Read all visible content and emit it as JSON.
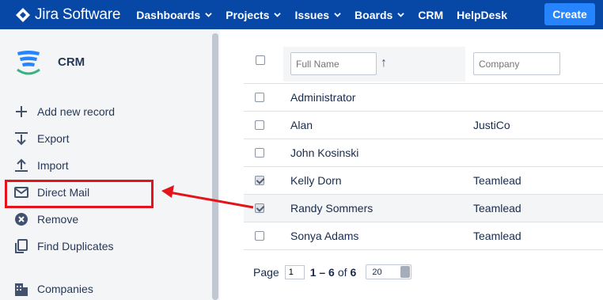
{
  "topbar": {
    "logo_text": "Jira Software",
    "nav": [
      {
        "label": "Dashboards",
        "has_caret": true
      },
      {
        "label": "Projects",
        "has_caret": true
      },
      {
        "label": "Issues",
        "has_caret": true
      },
      {
        "label": "Boards",
        "has_caret": true
      },
      {
        "label": "CRM",
        "has_caret": false
      },
      {
        "label": "HelpDesk",
        "has_caret": false
      }
    ],
    "create_label": "Create",
    "colors": {
      "bar": "#0747a6",
      "create": "#2684ff"
    }
  },
  "sidebar": {
    "project_name": "CRM",
    "items": [
      {
        "label": "Add new record",
        "icon": "plus-icon"
      },
      {
        "label": "Export",
        "icon": "export-icon"
      },
      {
        "label": "Import",
        "icon": "import-icon"
      },
      {
        "label": "Direct Mail",
        "icon": "mail-icon",
        "highlighted": true
      },
      {
        "label": "Remove",
        "icon": "remove-icon"
      },
      {
        "label": "Find Duplicates",
        "icon": "duplicates-icon"
      },
      {
        "label": "Companies",
        "icon": "companies-icon"
      }
    ],
    "highlight_color": "#e3141c"
  },
  "table": {
    "filters": {
      "name_placeholder": "Full Name",
      "company_placeholder": "Company"
    },
    "sort_icon": "sort-arrow-up-icon",
    "rows": [
      {
        "name": "Administrator",
        "company": "",
        "checked": false
      },
      {
        "name": "Alan",
        "company": "JustiCo",
        "checked": false
      },
      {
        "name": "John Kosinski",
        "company": "",
        "checked": false
      },
      {
        "name": "Kelly Dorn",
        "company": "Teamlead",
        "checked": true
      },
      {
        "name": "Randy Sommers",
        "company": "Teamlead",
        "checked": true
      },
      {
        "name": "Sonya Adams",
        "company": "Teamlead",
        "checked": false
      }
    ]
  },
  "pager": {
    "page_label": "Page",
    "page_value": "1",
    "range": "1 – 6",
    "of_label": "of",
    "total": "6",
    "page_size": "20"
  }
}
